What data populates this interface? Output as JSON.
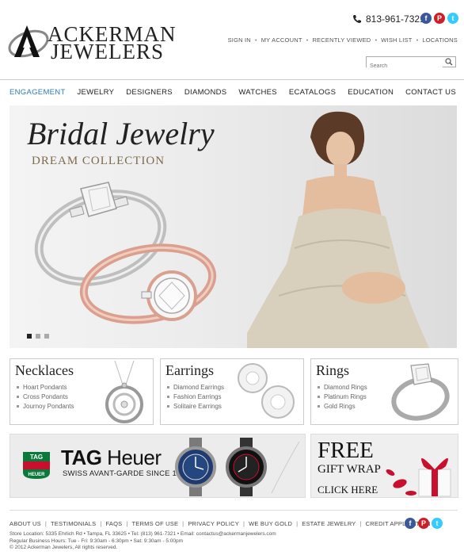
{
  "brand": {
    "line1": "ACKERMAN",
    "line2": "JEWELERS"
  },
  "contact": {
    "phone": "813-961-7321"
  },
  "social": [
    {
      "icon": "facebook-icon",
      "glyph": "f",
      "color": "#3b5998"
    },
    {
      "icon": "pinterest-icon",
      "glyph": "P",
      "color": "#cb2027"
    },
    {
      "icon": "twitter-icon",
      "glyph": "t",
      "color": "#33ccff"
    }
  ],
  "toplinks": [
    "SIGN IN",
    "MY ACCOUNT",
    "RECENTLY VIEWED",
    "WISH LIST",
    "LOCATIONS"
  ],
  "search": {
    "placeholder": "Search"
  },
  "nav": [
    {
      "label": "ENGAGEMENT",
      "active": true
    },
    {
      "label": "JEWELRY"
    },
    {
      "label": "DESIGNERS"
    },
    {
      "label": "DIAMONDS"
    },
    {
      "label": "WATCHES"
    },
    {
      "label": "ECATALOGS"
    },
    {
      "label": "EDUCATION"
    },
    {
      "label": "CONTACT US"
    }
  ],
  "hero": {
    "title": "Bridal Jewelry",
    "subtitle": "DREAM COLLECTION",
    "slides": 3,
    "active_slide": 1
  },
  "categories": [
    {
      "title": "Necklaces",
      "items": [
        "Hoart Pondants",
        "Cross Pondants",
        "Journoy Pondants"
      ]
    },
    {
      "title": "Earrings",
      "items": [
        "Diamond Earrings",
        "Fashion Earrings",
        "Solitaire Earrings"
      ]
    },
    {
      "title": "Rings",
      "items": [
        "Diamond Rings",
        "Platinum Rings",
        "Gold Rings"
      ]
    }
  ],
  "tag_banner": {
    "logo_text": "TAG HEUER",
    "name_bold": "TAG",
    "name_rest": " Heuer",
    "slogan": "SWISS AVANT-GARDE SINCE 1860"
  },
  "gift_banner": {
    "free": "FREE",
    "wrap": "GIFT WRAP",
    "cta": "CLICK HERE"
  },
  "footer": {
    "links": [
      "ABOUT US",
      "TESTIMONIALS",
      "FAQS",
      "TERMS OF USE",
      "PRIVACY POLICY",
      "WE BUY GOLD",
      "ESTATE JEWELRY",
      "CREDIT APPLICATION"
    ],
    "info": [
      "Store Location: 5335 Ehrlich Rd • Tampa,  FL  33625 • Tel: (813) 961-7321 • Email: contactus@ackermanjewelers.com",
      "Regular Business Hours: Tue - Fri: 9:30am - 6:30pm • Sat: 9:30am - 5:00pm",
      "© 2012 Ackerman Jewelers, All rights reserved."
    ]
  },
  "colors": {
    "accent": "#2a7fb0",
    "rose_gold": "#d9a08f",
    "gift_red": "#c8102e"
  }
}
